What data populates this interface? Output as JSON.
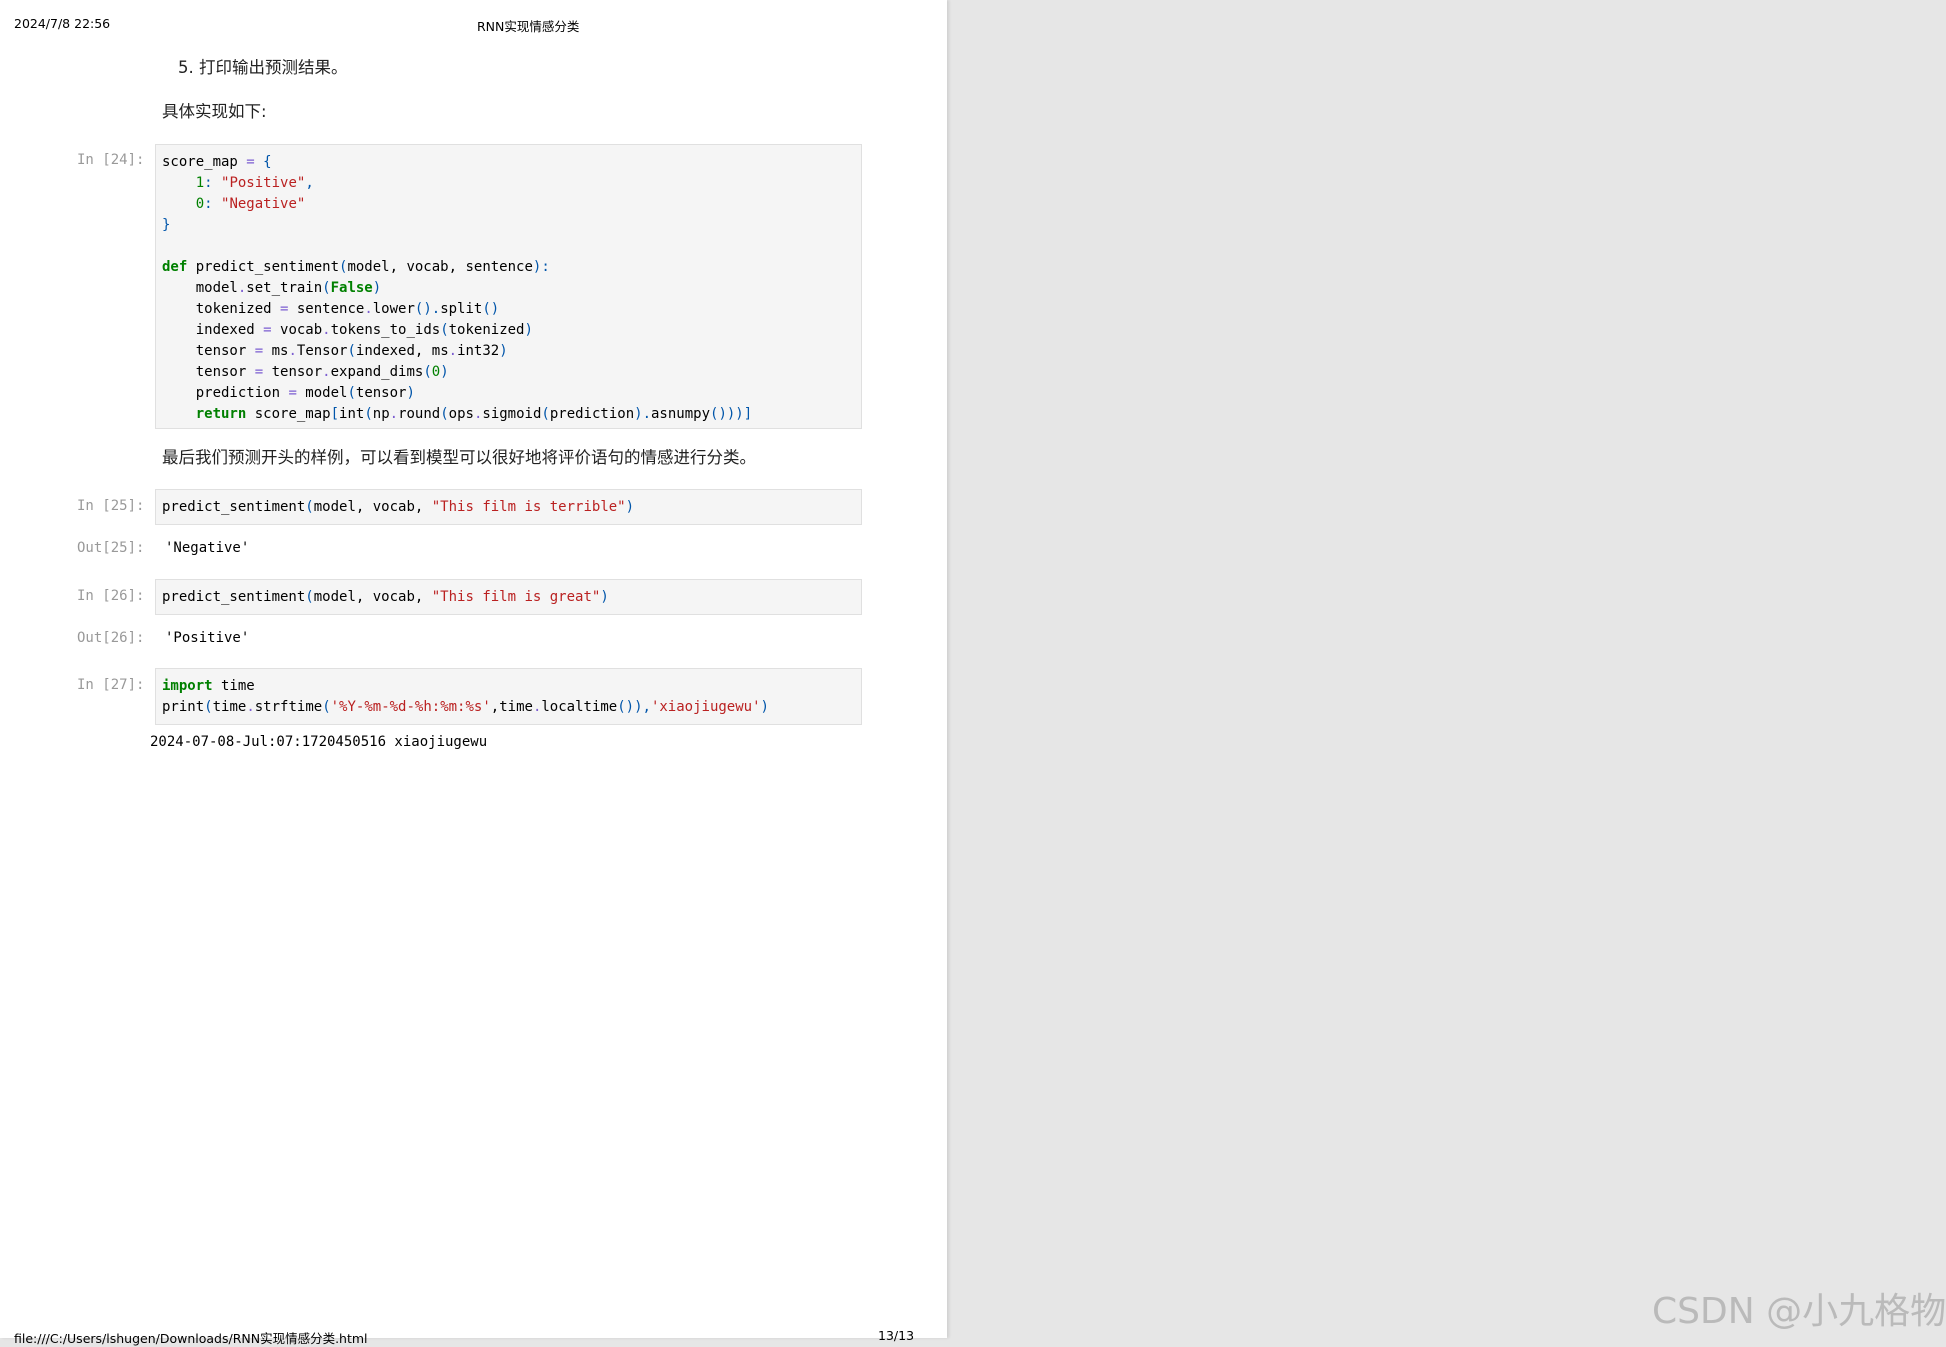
{
  "header": {
    "datetime": "2024/7/8 22:56",
    "title": "RNN实现情感分类"
  },
  "footer": {
    "path": "file:///C:/Users/lshugen/Downloads/RNN实现情感分类.html",
    "page": "13/13"
  },
  "markdown": {
    "step5": "5. 打印输出预测结果。",
    "impl_intro": "具体实现如下:",
    "final_note": "最后我们预测开头的样例，可以看到模型可以很好地将评价语句的情感进行分类。"
  },
  "cells": [
    {
      "prompt": "In [24]:"
    },
    {
      "prompt": "In [25]:",
      "out_prompt": "Out[25]:",
      "output": "'Negative'"
    },
    {
      "prompt": "In [26]:",
      "out_prompt": "Out[26]:",
      "output": "'Positive'"
    },
    {
      "prompt": "In [27]:",
      "stdout": "2024-07-08-Jul:07:1720450516 xiaojiugewu"
    }
  ],
  "code": {
    "c24": {
      "l1a": "score_map ",
      "l1b": "=",
      "l1c": " {",
      "l2a": "    ",
      "l2num": "1",
      "l2c": ": ",
      "l2str": "\"Positive\"",
      "l2e": ",",
      "l3a": "    ",
      "l3num": "0",
      "l3c": ": ",
      "l3str": "\"Negative\"",
      "l4": "}",
      "l6kw": "def",
      "l6a": " predict_sentiment",
      "l6b": "(",
      "l6c": "model, vocab, sentence",
      "l6d": "):",
      "l7a": "    model",
      "l7b": ".",
      "l7c": "set_train",
      "l7d": "(",
      "l7kw": "False",
      "l7e": ")",
      "l8a": "    tokenized ",
      "l8b": "=",
      "l8c": " sentence",
      "l8d": ".",
      "l8e": "lower",
      "l8f": "().",
      "l8g": "split",
      "l8h": "()",
      "l9a": "    indexed ",
      "l9b": "=",
      "l9c": " vocab",
      "l9d": ".",
      "l9e": "tokens_to_ids",
      "l9f": "(",
      "l9g": "tokenized",
      "l9h": ")",
      "l10a": "    tensor ",
      "l10b": "=",
      "l10c": " ms",
      "l10d": ".",
      "l10e": "Tensor",
      "l10f": "(",
      "l10g": "indexed, ms",
      "l10h": ".",
      "l10i": "int32",
      "l10j": ")",
      "l11a": "    tensor ",
      "l11b": "=",
      "l11c": " tensor",
      "l11d": ".",
      "l11e": "expand_dims",
      "l11f": "(",
      "l11num": "0",
      "l11g": ")",
      "l12a": "    prediction ",
      "l12b": "=",
      "l12c": " model",
      "l12d": "(",
      "l12e": "tensor",
      "l12f": ")",
      "l13a": "    ",
      "l13kw": "return",
      "l13b": " score_map",
      "l13c": "[",
      "l13d": "int",
      "l13e": "(",
      "l13f": "np",
      "l13g": ".",
      "l13h": "round",
      "l13i": "(",
      "l13j": "ops",
      "l13k": ".",
      "l13l": "sigmoid",
      "l13m": "(",
      "l13n": "prediction",
      "l13o": ").",
      "l13p": "asnumpy",
      "l13q": "()))]"
    },
    "c25": {
      "a": "predict_sentiment",
      "b": "(",
      "c": "model, vocab, ",
      "str": "\"This film is terrible\"",
      "d": ")"
    },
    "c26": {
      "a": "predict_sentiment",
      "b": "(",
      "c": "model, vocab, ",
      "str": "\"This film is great\"",
      "d": ")"
    },
    "c27": {
      "kw": "import",
      "l1": " time",
      "a": "print",
      "b": "(",
      "c": "time",
      "d": ".",
      "e": "strftime",
      "f": "(",
      "str1": "'%Y-%m-%d-%h:%m:%s'",
      "g": ",time",
      "h": ".",
      "i": "localtime",
      "j": "()),",
      "str2": "'xiaojiugewu'",
      "k": ")"
    }
  },
  "watermark": "CSDN @小九格物",
  "colors": {
    "keyword": "#008000",
    "string": "#ba2121",
    "operator": "#7c5dd1",
    "punctuation": "#0055aa",
    "prompt": "#999999",
    "page_bg": "#ffffff",
    "viewer_bg": "#e6e6e6"
  }
}
